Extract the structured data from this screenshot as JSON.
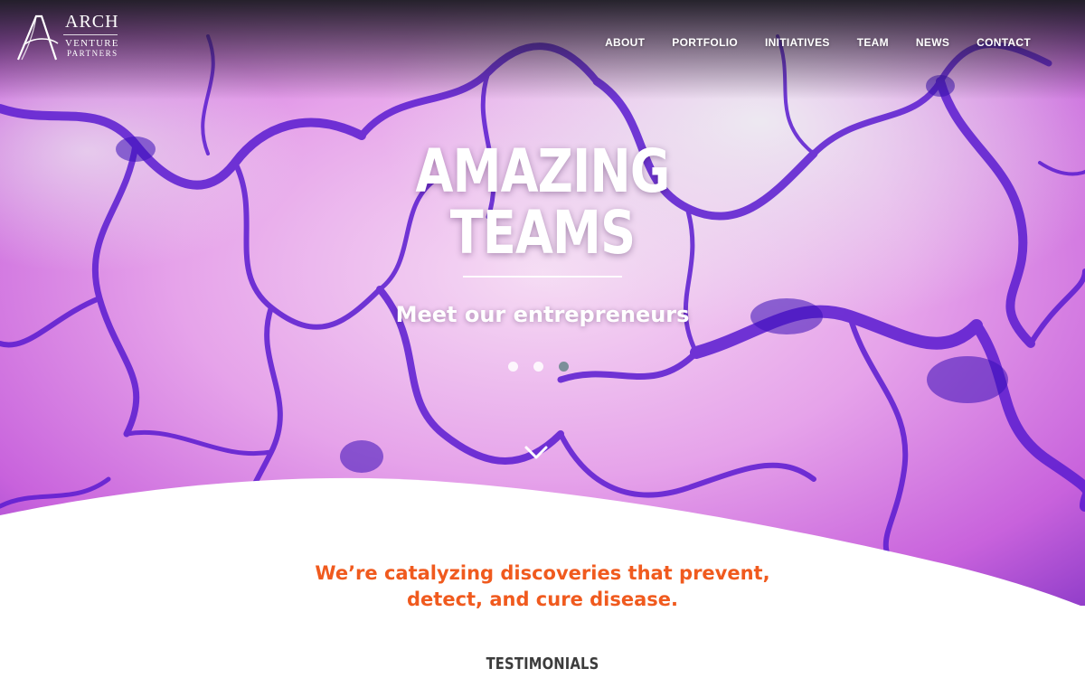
{
  "brand": {
    "name_line1": "ARCH",
    "name_line2": "VENTURE",
    "name_line3": "PARTNERS"
  },
  "nav": {
    "items": [
      {
        "label": "ABOUT"
      },
      {
        "label": "PORTFOLIO"
      },
      {
        "label": "INITIATIVES"
      },
      {
        "label": "TEAM"
      },
      {
        "label": "NEWS"
      },
      {
        "label": "CONTACT"
      }
    ]
  },
  "hero": {
    "title_line1": "AMAZING",
    "title_line2": "TEAMS",
    "subtitle": "Meet our entrepreneurs",
    "slides": 3,
    "active_slide": 3
  },
  "content": {
    "tagline_line1": "We’re catalyzing discoveries that prevent,",
    "tagline_line2": "detect, and cure disease.",
    "section_heading": "TESTIMONIALS"
  },
  "colors": {
    "accent": "#f05a1e",
    "hero_purple": "#6a1bd6",
    "hero_pink": "#e79af0",
    "dot_active": "#7c8f99",
    "heading": "#3c3c3c"
  },
  "icons": {
    "logo": "arch-logo-icon",
    "scroll": "chevron-down-icon"
  }
}
